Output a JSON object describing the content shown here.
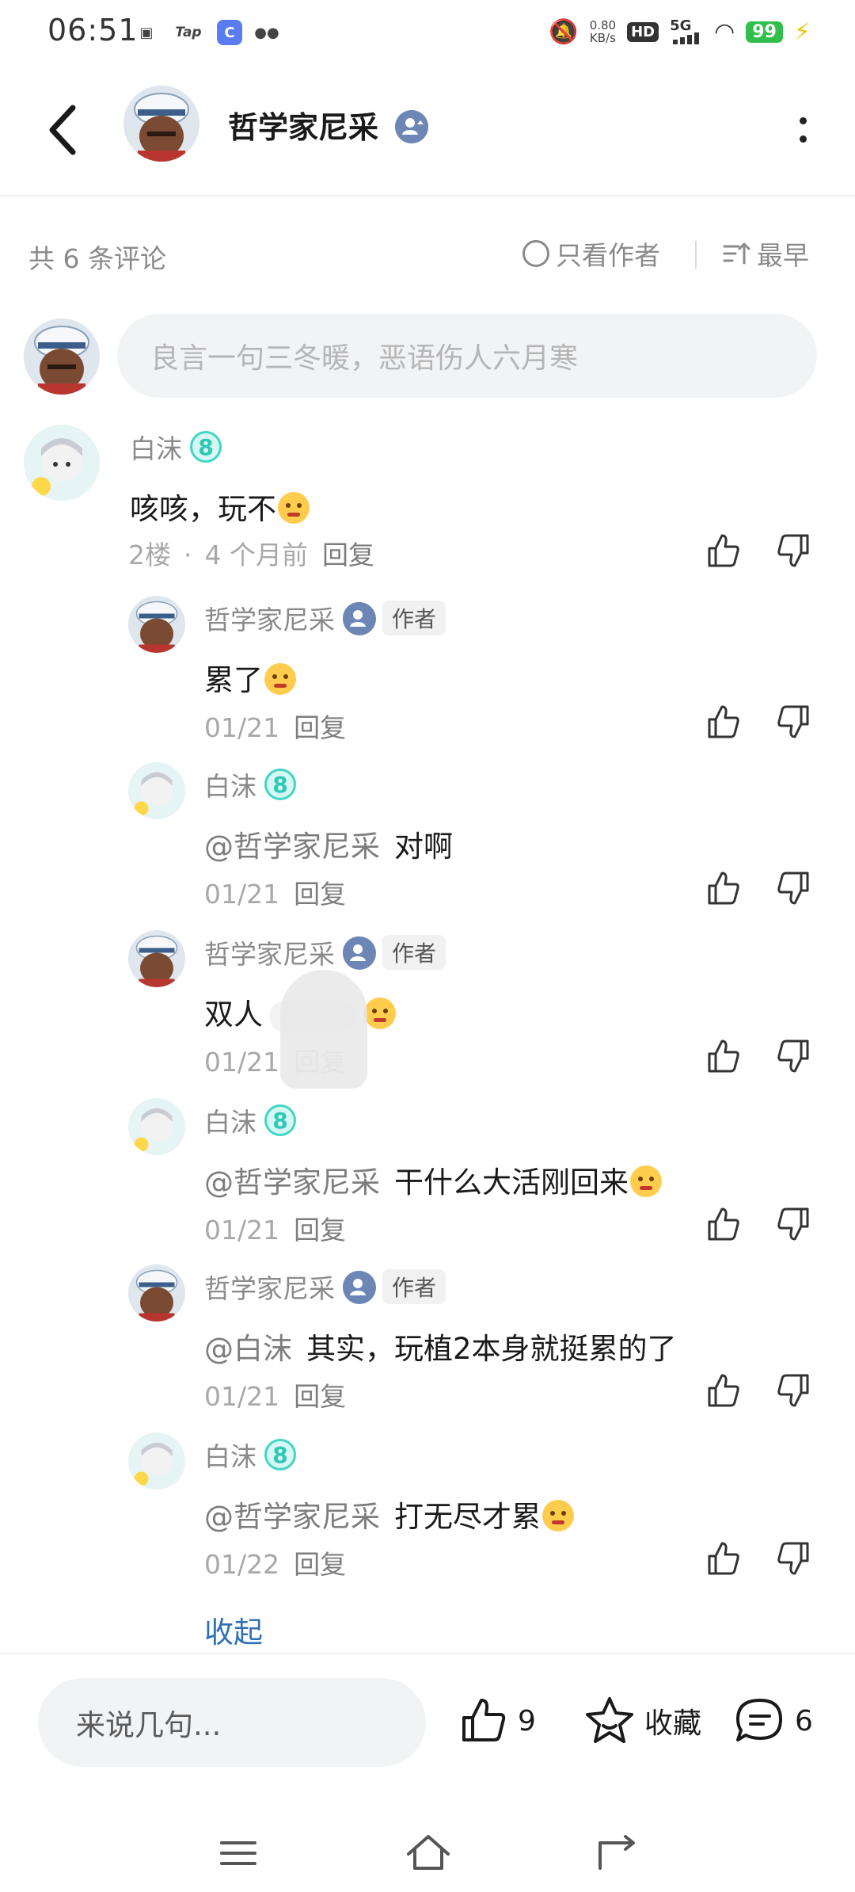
{
  "status_bar": {
    "time": "06:51",
    "left_icons": [
      "tv-icon",
      "Tap",
      "app-icon",
      "wechat-icon"
    ],
    "tap_label": "Tap",
    "net_speed_value": "0.80",
    "net_speed_unit": "KB/s",
    "hd_label": "HD",
    "network_label": "5G",
    "battery": "99"
  },
  "header": {
    "username": "哲学家尼采"
  },
  "summary": {
    "count_label": "共 6 条评论",
    "author_only_label": "只看作者",
    "sort_label": "最早"
  },
  "input": {
    "placeholder": "良言一句三冬暖，恶语伤人六月寒"
  },
  "comments": [
    {
      "name": "白沫",
      "level": "8",
      "text": "咳咳，玩不",
      "floor": "2楼",
      "time": "4 个月前",
      "reply": "回复"
    },
    {
      "name": "哲学家尼采",
      "badge": "作者",
      "text": "累了",
      "time": "01/21",
      "reply": "回复"
    },
    {
      "name": "白沫",
      "level": "8",
      "mention": "@哲学家尼采",
      "text": "对啊",
      "time": "01/21",
      "reply": "回复"
    },
    {
      "name": "哲学家尼采",
      "badge": "作者",
      "text": "双人",
      "time": "01/21",
      "reply": "回复"
    },
    {
      "name": "白沫",
      "level": "8",
      "mention": "@哲学家尼采",
      "text": "干什么大活刚回来",
      "time": "01/21",
      "reply": "回复"
    },
    {
      "name": "哲学家尼采",
      "badge": "作者",
      "mention": "@白沫",
      "text": "其实，玩植2本身就挺累的了",
      "time": "01/21",
      "reply": "回复"
    },
    {
      "name": "白沫",
      "level": "8",
      "mention": "@哲学家尼采",
      "text": "打无尽才累",
      "time": "01/22",
      "reply": "回复"
    }
  ],
  "collapse_label": "收起",
  "bottom_bar": {
    "reply_placeholder": "来说几句...",
    "like_count": "9",
    "favorite_label": "收藏",
    "comment_count": "6"
  },
  "colors": {
    "accent_link": "#2f6fb3",
    "level_badge": "#2ec8b6",
    "battery": "#2fbf4a"
  }
}
